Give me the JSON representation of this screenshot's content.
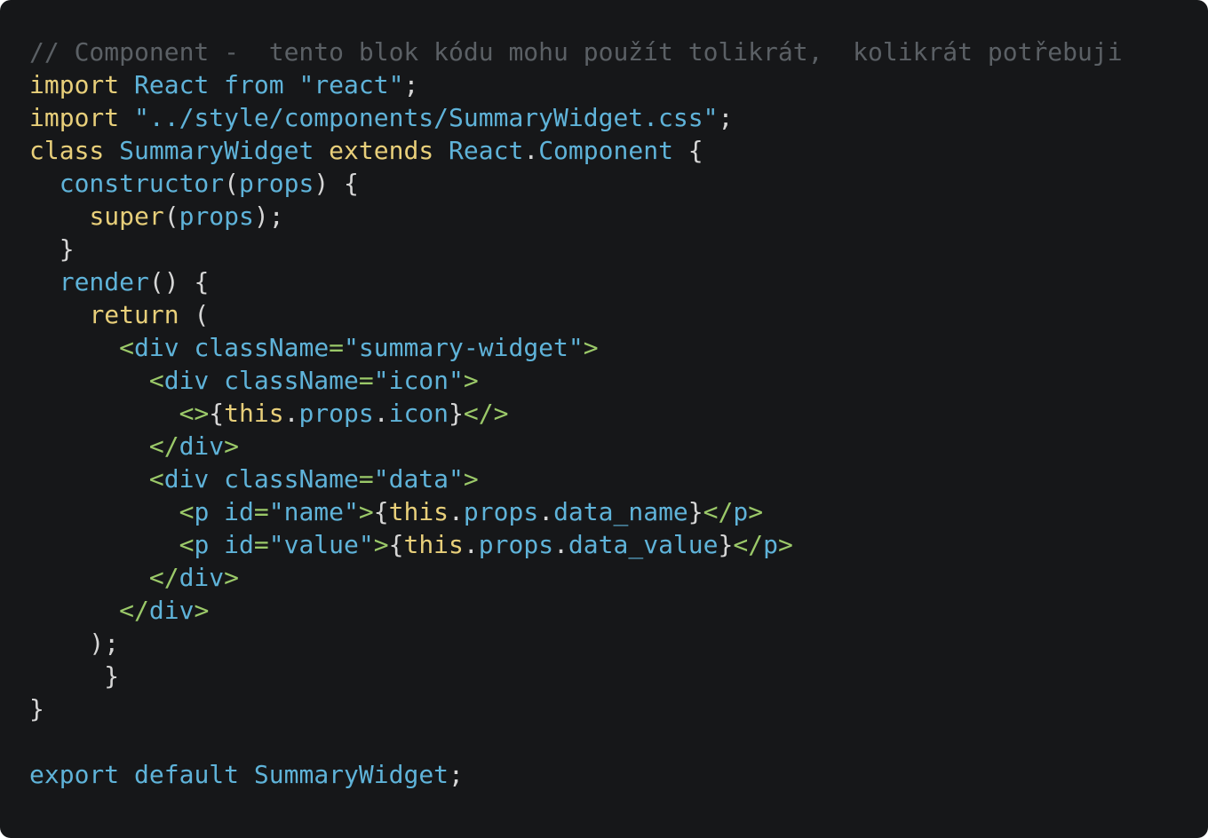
{
  "colors": {
    "background": "#161719",
    "comment": "#5b6065",
    "keyword": "#e8cf7a",
    "identifier": "#5fb3d9",
    "punctuation": "#d6d6d6",
    "tag": "#9bc969"
  },
  "code": {
    "lines": [
      [
        {
          "t": "// Component -  tento blok kódu mohu použít tolikrát,  kolikrát potřebuji",
          "k": "comment"
        }
      ],
      [
        {
          "t": "import",
          "k": "keyword"
        },
        {
          "t": " ",
          "k": "punctuation"
        },
        {
          "t": "React",
          "k": "identifier"
        },
        {
          "t": " ",
          "k": "punctuation"
        },
        {
          "t": "from",
          "k": "identifier"
        },
        {
          "t": " ",
          "k": "punctuation"
        },
        {
          "t": "\"react\"",
          "k": "identifier"
        },
        {
          "t": ";",
          "k": "punctuation"
        }
      ],
      [
        {
          "t": "import",
          "k": "keyword"
        },
        {
          "t": " ",
          "k": "punctuation"
        },
        {
          "t": "\"../style/components/SummaryWidget.css\"",
          "k": "identifier"
        },
        {
          "t": ";",
          "k": "punctuation"
        }
      ],
      [
        {
          "t": "class",
          "k": "keyword"
        },
        {
          "t": " ",
          "k": "punctuation"
        },
        {
          "t": "SummaryWidget",
          "k": "identifier"
        },
        {
          "t": " ",
          "k": "punctuation"
        },
        {
          "t": "extends",
          "k": "keyword"
        },
        {
          "t": " ",
          "k": "punctuation"
        },
        {
          "t": "React",
          "k": "identifier"
        },
        {
          "t": ".",
          "k": "punctuation"
        },
        {
          "t": "Component",
          "k": "identifier"
        },
        {
          "t": " {",
          "k": "punctuation"
        }
      ],
      [
        {
          "t": "  ",
          "k": "punctuation"
        },
        {
          "t": "constructor",
          "k": "identifier"
        },
        {
          "t": "(",
          "k": "punctuation"
        },
        {
          "t": "props",
          "k": "identifier"
        },
        {
          "t": ") {",
          "k": "punctuation"
        }
      ],
      [
        {
          "t": "    ",
          "k": "punctuation"
        },
        {
          "t": "super",
          "k": "keyword"
        },
        {
          "t": "(",
          "k": "punctuation"
        },
        {
          "t": "props",
          "k": "identifier"
        },
        {
          "t": ");",
          "k": "punctuation"
        }
      ],
      [
        {
          "t": "  }",
          "k": "punctuation"
        }
      ],
      [
        {
          "t": "  ",
          "k": "punctuation"
        },
        {
          "t": "render",
          "k": "identifier"
        },
        {
          "t": "() {",
          "k": "punctuation"
        }
      ],
      [
        {
          "t": "    ",
          "k": "punctuation"
        },
        {
          "t": "return",
          "k": "keyword"
        },
        {
          "t": " (",
          "k": "punctuation"
        }
      ],
      [
        {
          "t": "      ",
          "k": "punctuation"
        },
        {
          "t": "<",
          "k": "tag"
        },
        {
          "t": "div",
          "k": "identifier"
        },
        {
          "t": " ",
          "k": "punctuation"
        },
        {
          "t": "className",
          "k": "identifier"
        },
        {
          "t": "=",
          "k": "tag"
        },
        {
          "t": "\"summary-widget\"",
          "k": "identifier"
        },
        {
          "t": ">",
          "k": "tag"
        }
      ],
      [
        {
          "t": "        ",
          "k": "punctuation"
        },
        {
          "t": "<",
          "k": "tag"
        },
        {
          "t": "div",
          "k": "identifier"
        },
        {
          "t": " ",
          "k": "punctuation"
        },
        {
          "t": "className",
          "k": "identifier"
        },
        {
          "t": "=",
          "k": "tag"
        },
        {
          "t": "\"icon\"",
          "k": "identifier"
        },
        {
          "t": ">",
          "k": "tag"
        }
      ],
      [
        {
          "t": "          ",
          "k": "punctuation"
        },
        {
          "t": "<>",
          "k": "tag"
        },
        {
          "t": "{",
          "k": "punctuation"
        },
        {
          "t": "this",
          "k": "keyword"
        },
        {
          "t": ".",
          "k": "punctuation"
        },
        {
          "t": "props",
          "k": "identifier"
        },
        {
          "t": ".",
          "k": "punctuation"
        },
        {
          "t": "icon",
          "k": "identifier"
        },
        {
          "t": "}",
          "k": "punctuation"
        },
        {
          "t": "</>",
          "k": "tag"
        }
      ],
      [
        {
          "t": "        ",
          "k": "punctuation"
        },
        {
          "t": "</",
          "k": "tag"
        },
        {
          "t": "div",
          "k": "identifier"
        },
        {
          "t": ">",
          "k": "tag"
        }
      ],
      [
        {
          "t": "        ",
          "k": "punctuation"
        },
        {
          "t": "<",
          "k": "tag"
        },
        {
          "t": "div",
          "k": "identifier"
        },
        {
          "t": " ",
          "k": "punctuation"
        },
        {
          "t": "className",
          "k": "identifier"
        },
        {
          "t": "=",
          "k": "tag"
        },
        {
          "t": "\"data\"",
          "k": "identifier"
        },
        {
          "t": ">",
          "k": "tag"
        }
      ],
      [
        {
          "t": "          ",
          "k": "punctuation"
        },
        {
          "t": "<",
          "k": "tag"
        },
        {
          "t": "p",
          "k": "identifier"
        },
        {
          "t": " ",
          "k": "punctuation"
        },
        {
          "t": "id",
          "k": "identifier"
        },
        {
          "t": "=",
          "k": "tag"
        },
        {
          "t": "\"name\"",
          "k": "identifier"
        },
        {
          "t": ">",
          "k": "tag"
        },
        {
          "t": "{",
          "k": "punctuation"
        },
        {
          "t": "this",
          "k": "keyword"
        },
        {
          "t": ".",
          "k": "punctuation"
        },
        {
          "t": "props",
          "k": "identifier"
        },
        {
          "t": ".",
          "k": "punctuation"
        },
        {
          "t": "data_name",
          "k": "identifier"
        },
        {
          "t": "}",
          "k": "punctuation"
        },
        {
          "t": "</",
          "k": "tag"
        },
        {
          "t": "p",
          "k": "identifier"
        },
        {
          "t": ">",
          "k": "tag"
        }
      ],
      [
        {
          "t": "          ",
          "k": "punctuation"
        },
        {
          "t": "<",
          "k": "tag"
        },
        {
          "t": "p",
          "k": "identifier"
        },
        {
          "t": " ",
          "k": "punctuation"
        },
        {
          "t": "id",
          "k": "identifier"
        },
        {
          "t": "=",
          "k": "tag"
        },
        {
          "t": "\"value\"",
          "k": "identifier"
        },
        {
          "t": ">",
          "k": "tag"
        },
        {
          "t": "{",
          "k": "punctuation"
        },
        {
          "t": "this",
          "k": "keyword"
        },
        {
          "t": ".",
          "k": "punctuation"
        },
        {
          "t": "props",
          "k": "identifier"
        },
        {
          "t": ".",
          "k": "punctuation"
        },
        {
          "t": "data_value",
          "k": "identifier"
        },
        {
          "t": "}",
          "k": "punctuation"
        },
        {
          "t": "</",
          "k": "tag"
        },
        {
          "t": "p",
          "k": "identifier"
        },
        {
          "t": ">",
          "k": "tag"
        }
      ],
      [
        {
          "t": "        ",
          "k": "punctuation"
        },
        {
          "t": "</",
          "k": "tag"
        },
        {
          "t": "div",
          "k": "identifier"
        },
        {
          "t": ">",
          "k": "tag"
        }
      ],
      [
        {
          "t": "      ",
          "k": "punctuation"
        },
        {
          "t": "</",
          "k": "tag"
        },
        {
          "t": "div",
          "k": "identifier"
        },
        {
          "t": ">",
          "k": "tag"
        }
      ],
      [
        {
          "t": "    );",
          "k": "punctuation"
        }
      ],
      [
        {
          "t": "     }",
          "k": "punctuation"
        }
      ],
      [
        {
          "t": "}",
          "k": "punctuation"
        }
      ],
      [],
      [
        {
          "t": "export",
          "k": "identifier"
        },
        {
          "t": " ",
          "k": "punctuation"
        },
        {
          "t": "default",
          "k": "identifier"
        },
        {
          "t": " ",
          "k": "punctuation"
        },
        {
          "t": "SummaryWidget",
          "k": "identifier"
        },
        {
          "t": ";",
          "k": "punctuation"
        }
      ]
    ]
  }
}
